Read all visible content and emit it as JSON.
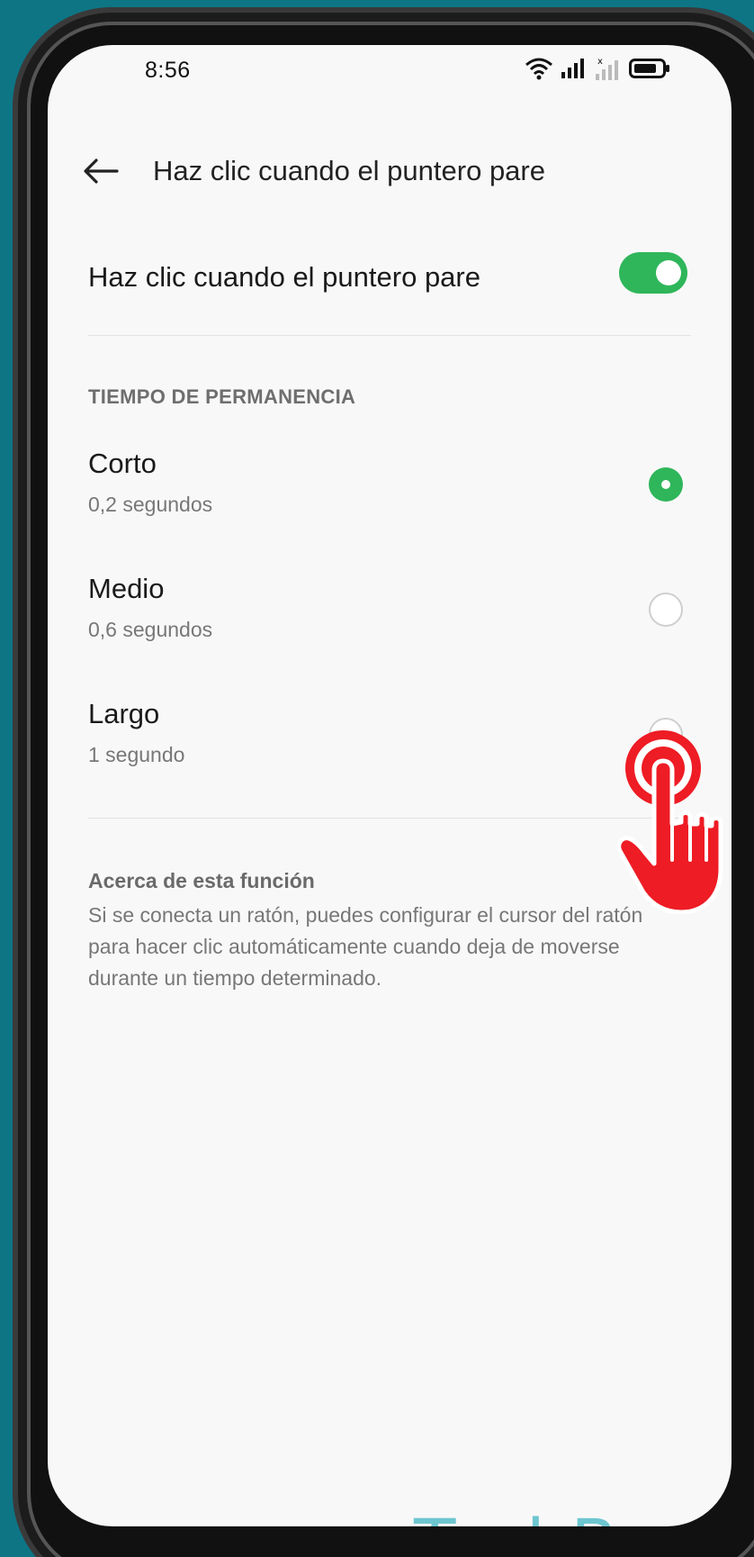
{
  "status_bar": {
    "time": "8:56"
  },
  "app_bar": {
    "back_icon": "arrow-left-icon",
    "title": "Haz clic cuando el puntero pare"
  },
  "toggle_setting": {
    "label": "Haz clic cuando el puntero pare",
    "enabled": true,
    "accent_color": "#2fb65a"
  },
  "dwell_section": {
    "header": "TIEMPO DE PERMANENCIA",
    "selected": "Corto",
    "options": [
      {
        "title": "Corto",
        "subtitle": "0,2 segundos",
        "checked": true
      },
      {
        "title": "Medio",
        "subtitle": "0,6 segundos",
        "checked": false
      },
      {
        "title": "Largo",
        "subtitle": "1 segundo",
        "checked": false
      }
    ]
  },
  "about": {
    "title": "Acerca de esta función",
    "text": "Si se conecta un ratón, puedes configurar el cursor del ratón para hacer clic automáticamente cuando deja de moverse durante un tiempo determinado."
  },
  "watermark": "TechBone",
  "overlay_icon": "tap-hand-icon"
}
